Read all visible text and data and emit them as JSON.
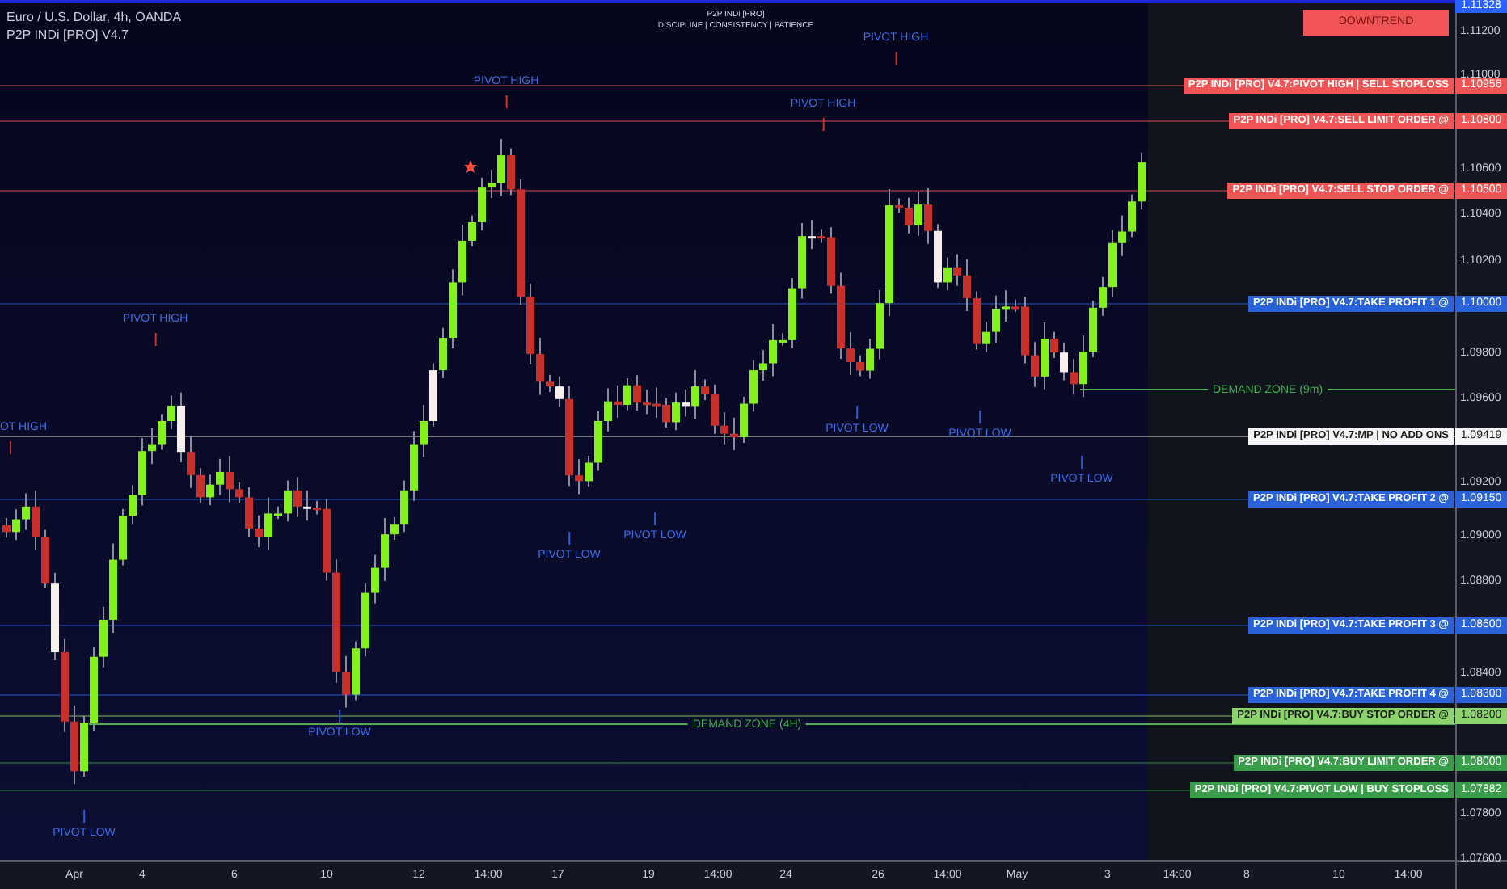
{
  "header": {
    "title": "Euro / U.S. Dollar, 4h, OANDA",
    "indicator": "P2P INDi [PRO] V4.7"
  },
  "banner": {
    "title": "P2P INDi [PRO]",
    "motto": "DISCIPLINE | CONSISTENCY | PATIENCE"
  },
  "trend_badge": {
    "label": "DOWNTREND",
    "color": "#f05454"
  },
  "last_price": "1.11328",
  "price_axis": [
    "1.11200",
    "1.11000",
    "1.10600",
    "1.10400",
    "1.10200",
    "1.09800",
    "1.09600",
    "1.09200",
    "1.09000",
    "1.08800",
    "1.08400",
    "1.07800",
    "1.07600"
  ],
  "time_axis": [
    "Apr",
    "4",
    "6",
    "10",
    "12",
    "14:00",
    "17",
    "19",
    "14:00",
    "24",
    "26",
    "14:00",
    "May",
    "3",
    "14:00",
    "8",
    "10",
    "14:00"
  ],
  "level_tags": [
    {
      "label": "P2P INDi [PRO] V4.7:PIVOT HIGH | SELL STOPLOSS",
      "price": "1.10956",
      "color": "#f05454"
    },
    {
      "label": "P2P INDi [PRO] V4.7:SELL LIMIT ORDER @",
      "price": "1.10800",
      "color": "#f05454"
    },
    {
      "label": "P2P INDi [PRO] V4.7:SELL STOP ORDER @",
      "price": "1.10500",
      "color": "#f05454"
    },
    {
      "label": "P2P INDi [PRO] V4.7:TAKE PROFIT 1 @",
      "price": "1.10000",
      "color": "#2962d9"
    },
    {
      "label": "P2P INDi [PRO] V4.7:MP | NO ADD ONS",
      "price": "1.09419",
      "color": "#f5f5f5"
    },
    {
      "label": "P2P INDi [PRO] V4.7:TAKE PROFIT 2 @",
      "price": "1.09150",
      "color": "#2962d9"
    },
    {
      "label": "P2P INDi [PRO] V4.7:TAKE PROFIT 3 @",
      "price": "1.08600",
      "color": "#2962d9"
    },
    {
      "label": "P2P INDi [PRO] V4.7:TAKE PROFIT 4 @",
      "price": "1.08300",
      "color": "#2962d9"
    },
    {
      "label": "P2P INDi [PRO] V4.7:BUY STOP ORDER @",
      "price": "1.08200",
      "color": "#8bd46b"
    },
    {
      "label": "P2P INDi [PRO] V4.7:BUY LIMIT ORDER @",
      "price": "1.08000",
      "color": "#3a9d4a"
    },
    {
      "label": "P2P INDi [PRO] V4.7:PIVOT LOW | BUY STOPLOSS",
      "price": "1.07882",
      "color": "#3a9d4a"
    }
  ],
  "annotations": [
    {
      "kind": "pivot_high",
      "text": "PIVOT HIGH"
    },
    {
      "kind": "pivot_high",
      "text": "PIVOT HIGH"
    },
    {
      "kind": "pivot_high",
      "text": "OT HIGH"
    },
    {
      "kind": "pivot_high",
      "text": "PIVOT HIGH"
    },
    {
      "kind": "pivot_high",
      "text": "PIVOT HIGH"
    },
    {
      "kind": "pivot_low",
      "text": "PIVOT LOW"
    },
    {
      "kind": "pivot_low",
      "text": "PIVOT LOW"
    },
    {
      "kind": "pivot_low",
      "text": "PIVOT LOW"
    },
    {
      "kind": "pivot_low",
      "text": "PIVOT LOW"
    },
    {
      "kind": "pivot_low",
      "text": "PIVOT LOW"
    },
    {
      "kind": "pivot_low",
      "text": "PIVOT LOW"
    },
    {
      "kind": "pivot_low",
      "text": "PIVOT LOW"
    }
  ],
  "zones": [
    {
      "text": "DEMAND ZONE (4H)"
    },
    {
      "text": "DEMAND ZONE (9m)"
    }
  ]
}
